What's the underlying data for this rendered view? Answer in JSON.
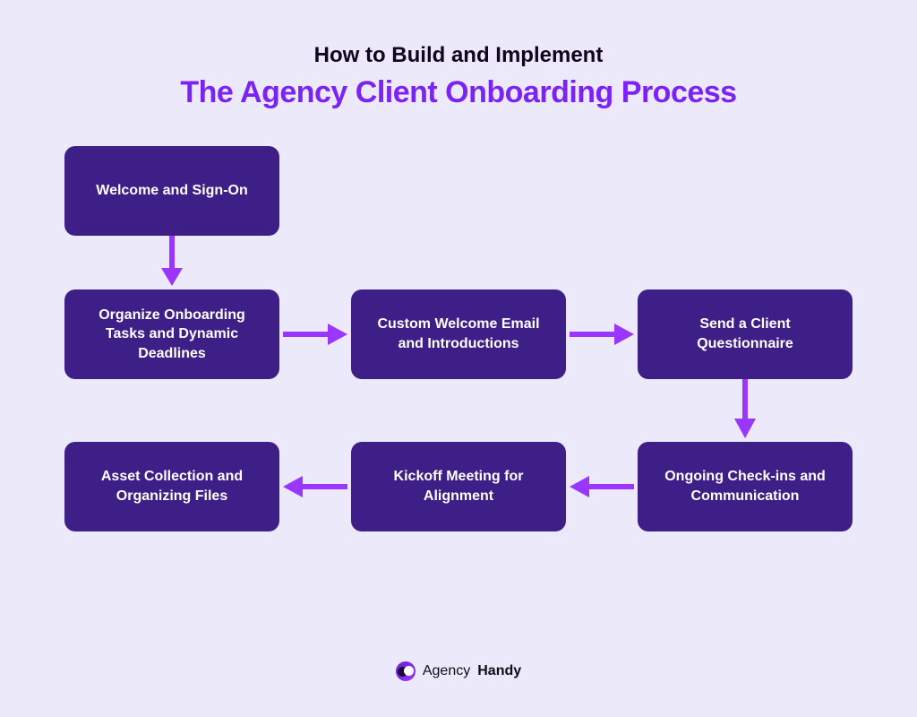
{
  "title": {
    "line1": "How to Build and Implement",
    "line2": "The Agency Client Onboarding Process"
  },
  "nodes": {
    "n1": "Welcome and Sign-On",
    "n2": "Organize Onboarding Tasks and Dynamic Deadlines",
    "n3": "Custom Welcome Email and Introductions",
    "n4": "Send a Client Questionnaire",
    "n5": "Ongoing Check-ins and Communication",
    "n6": "Kickoff Meeting for Alignment",
    "n7": "Asset Collection and Organizing Files"
  },
  "arrows": {
    "a1_dir": "down",
    "a2_dir": "right",
    "a3_dir": "right",
    "a4_dir": "down",
    "a5_dir": "left",
    "a6_dir": "left"
  },
  "brand": {
    "word1": "Agency",
    "word2": "Handy"
  },
  "colors": {
    "background": "#ece9fa",
    "node_fill": "#3e1f87",
    "accent_arrow": "#9a36ff",
    "title_accent": "#7b22f5"
  }
}
